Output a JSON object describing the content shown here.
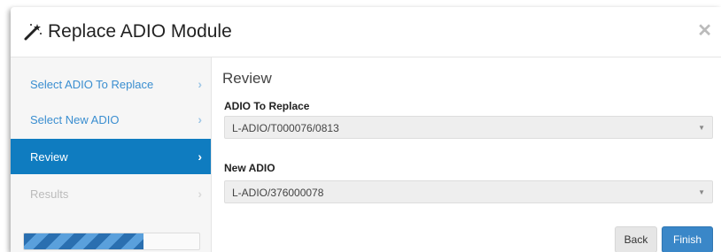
{
  "modal": {
    "title": "Replace ADIO Module",
    "close_symbol": "✕"
  },
  "steps": [
    {
      "label": "Select ADIO To Replace",
      "state": "link"
    },
    {
      "label": "Select New ADIO",
      "state": "link"
    },
    {
      "label": "Review",
      "state": "active"
    },
    {
      "label": "Results",
      "state": "disabled"
    }
  ],
  "progress": {
    "fraction": 0.68
  },
  "review": {
    "heading": "Review",
    "adio_to_replace_label": "ADIO To Replace",
    "adio_to_replace_value": "L-ADIO/T000076/0813",
    "new_adio_label": "New ADIO",
    "new_adio_value": "L-ADIO/376000078"
  },
  "buttons": {
    "back": "Back",
    "finish": "Finish"
  },
  "colors": {
    "accent": "#0f7cc0",
    "link": "#3a8ed0",
    "primary_button": "#3a87c8"
  },
  "icons": {
    "title": "magic-wand-icon",
    "step_chevron": "chevron-right-icon",
    "select_caret": "caret-down-icon"
  }
}
